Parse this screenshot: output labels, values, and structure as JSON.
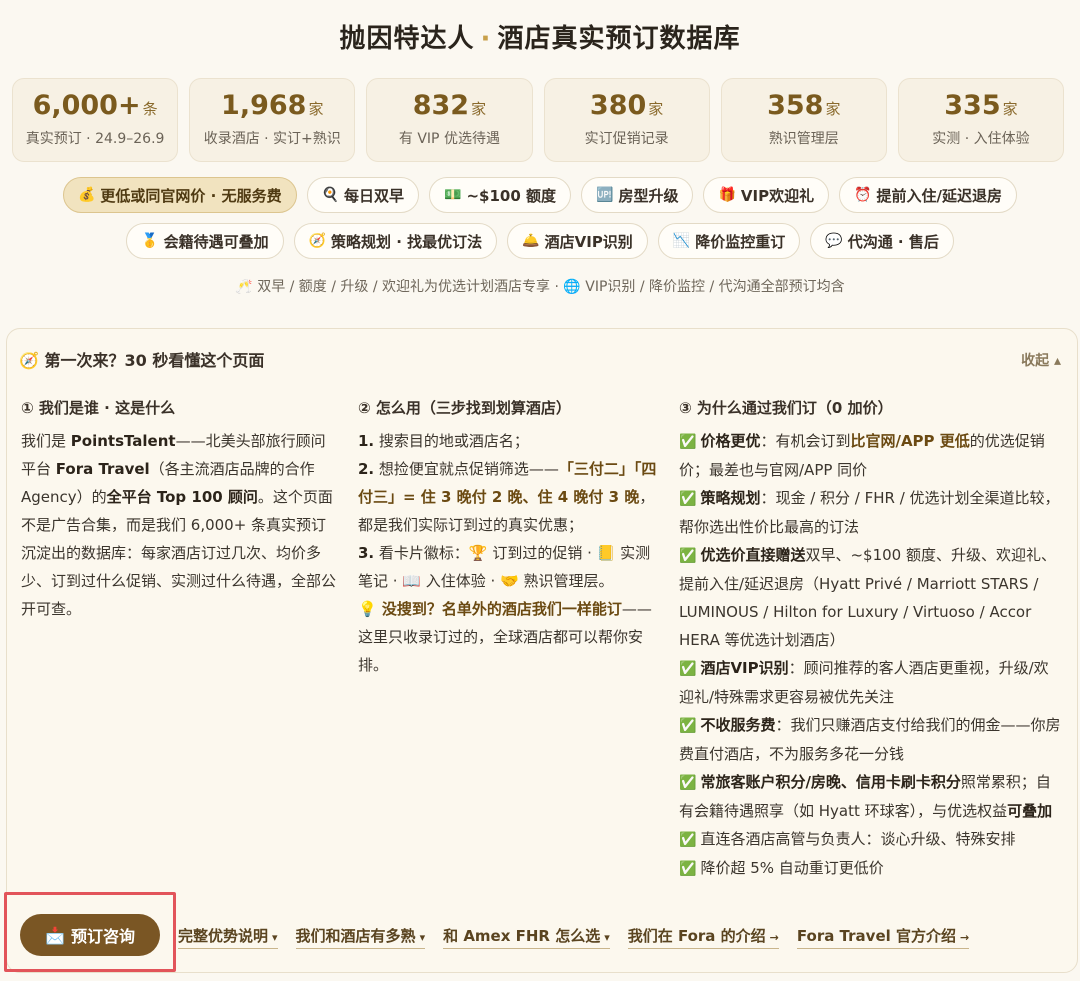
{
  "header": {
    "title_left": "抛因特达人",
    "title_dot": "·",
    "title_right": "酒店真实预订数据库"
  },
  "stats": [
    {
      "value": "6,000+",
      "unit": "条",
      "label": "真实预订 · 24.9–26.9"
    },
    {
      "value": "1,968",
      "unit": "家",
      "label": "收录酒店 · 实订+熟识"
    },
    {
      "value": "832",
      "unit": "家",
      "label": "有 VIP 优选待遇"
    },
    {
      "value": "380",
      "unit": "家",
      "label": "实订促销记录"
    },
    {
      "value": "358",
      "unit": "家",
      "label": "熟识管理层"
    },
    {
      "value": "335",
      "unit": "家",
      "label": "实测 · 入住体验"
    }
  ],
  "chips_row1": [
    {
      "icon": "💰",
      "label": "更低或同官网价 · 无服务费",
      "icon_name": "money-bag-icon"
    },
    {
      "icon": "🍳",
      "label": "每日双早",
      "icon_name": "breakfast-icon"
    },
    {
      "icon": "💵",
      "label": "~$100 额度",
      "icon_name": "cash-icon"
    },
    {
      "icon": "🆙",
      "label": "房型升级",
      "icon_name": "upgrade-icon"
    },
    {
      "icon": "🎁",
      "label": "VIP欢迎礼",
      "icon_name": "gift-icon"
    },
    {
      "icon": "⏰",
      "label": "提前入住/延迟退房",
      "icon_name": "alarm-clock-icon"
    }
  ],
  "chips_row2": [
    {
      "icon": "🥇",
      "label": "会籍待遇可叠加",
      "icon_name": "medal-icon"
    },
    {
      "icon": "🧭",
      "label": "策略规划 · 找最优订法",
      "icon_name": "compass-icon"
    },
    {
      "icon": "🛎️",
      "label": "酒店VIP识别",
      "icon_name": "bellhop-icon"
    },
    {
      "icon": "📉",
      "label": "降价监控重订",
      "icon_name": "chart-down-icon"
    },
    {
      "icon": "💬",
      "label": "代沟通 · 售后",
      "icon_name": "speech-bubble-icon"
    }
  ],
  "note": "🥂 双早 / 额度 / 升级 / 欢迎礼为优选计划酒店专享 · 🌐 VIP识别 / 降价监控 / 代沟通全部预订均含",
  "panel": {
    "title": "🧭 第一次来？30 秒看懂这个页面",
    "collapse": "收起 ▴",
    "col1": {
      "heading": "① 我们是谁 · 这是什么",
      "p1": "我们是 ",
      "brand": "PointsTalent",
      "p2": "——北美头部旅行顾问平台 ",
      "fora": "Fora Travel",
      "p3": "（各主流酒店品牌的合作 Agency）的",
      "top": "全平台 Top 100 顾问",
      "p4": "。这个页面不是广告合集，而是我们 6,000+ 条真实预订沉淀出的数据库：每家酒店订过几次、均价多少、订到过什么促销、实测过什么待遇，全部公开可查。"
    },
    "col2": {
      "heading": "② 怎么用（三步找到划算酒店）",
      "s1n": "1.",
      "s1": " 搜索目的地或酒店名；",
      "s2n": "2.",
      "s2a": " 想捡便宜就点促销筛选——",
      "s2b": "「三付二」「四付三」= 住 3 晚付 2 晚、住 4 晚付 3 晚",
      "s2c": "，都是我们实际订到过的真实优惠；",
      "s3n": "3.",
      "s3": " 看卡片徽标：🏆 订到过的促销 · 📒 实测笔记 · 📖 入住体验 · 🤝 熟识管理层。",
      "tip_icon": "💡",
      "tip_b": " 没搜到？名单外的酒店我们一样能订",
      "tip": "——这里只收录订过的，全球酒店都可以帮你安排。"
    },
    "col3": {
      "heading": "③ 为什么通过我们订（0 加价）",
      "items": [
        {
          "b": "价格更优",
          "t1": "：有机会订到",
          "b2": "比官网/APP 更低",
          "t2": "的优选促销价；最差也与官网/APP 同价"
        },
        {
          "b": "策略规划",
          "t1": "：现金 / 积分 / FHR / 优选计划全渠道比较，帮你选出性价比最高的订法",
          "b2": "",
          "t2": ""
        },
        {
          "b": "优选价直接赠送",
          "t1": "双早、~$100 额度、升级、欢迎礼、提前入住/延迟退房（Hyatt Privé / Marriott STARS / LUMINOUS / Hilton for Luxury / Virtuoso / Accor HERA 等优选计划酒店）",
          "b2": "",
          "t2": ""
        },
        {
          "b": "酒店VIP识别",
          "t1": "：顾问推荐的客人酒店更重视，升级/欢迎礼/特殊需求更容易被优先关注",
          "b2": "",
          "t2": ""
        },
        {
          "b": "不收服务费",
          "t1": "：我们只赚酒店支付给我们的佣金——你房费直付酒店，不为服务多花一分钱",
          "b2": "",
          "t2": ""
        },
        {
          "b": "常旅客账户积分/房晚、信用卡刷卡积分",
          "t1": "照常累积；自有会籍待遇照享（如 Hyatt 环球客），与优选权益",
          "b2": "可叠加",
          "t2": ""
        },
        {
          "b": "",
          "t1": "直连各酒店高管与负责人：谈心升级、特殊安排",
          "b2": "",
          "t2": ""
        },
        {
          "b": "",
          "t1": "降价超 5% 自动重订更低价",
          "b2": "",
          "t2": ""
        }
      ]
    }
  },
  "cta": {
    "icon": "📩",
    "label": "预订咨询"
  },
  "links": [
    {
      "label": "完整优势说明",
      "suffix": "▾"
    },
    {
      "label": "我们和酒店有多熟",
      "suffix": "▾"
    },
    {
      "label": "和 Amex FHR 怎么选",
      "suffix": "▾"
    },
    {
      "label": "我们在 Fora 的介绍",
      "suffix": "→"
    },
    {
      "label": "Fora Travel 官方介绍",
      "suffix": "→"
    }
  ],
  "colors": {
    "accent": "#7a5624",
    "highlight_frame": "#e2545a",
    "check": "#2e9e3f"
  }
}
